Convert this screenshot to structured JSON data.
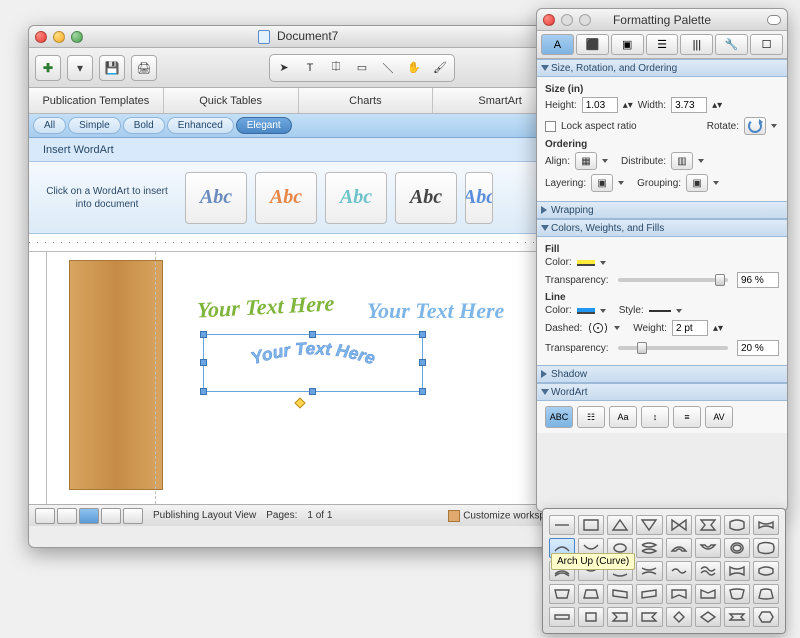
{
  "main": {
    "title": "Document7",
    "elements_tabs": [
      "Publication Templates",
      "Quick Tables",
      "Charts",
      "SmartArt"
    ],
    "filter_tabs": [
      "All",
      "Simple",
      "Bold",
      "Enhanced",
      "Elegant"
    ],
    "filter_active": "Elegant",
    "insert_label": "Insert WordArt",
    "hint": "Click on a WordArt to insert into document",
    "wa_sample": "Abc",
    "canvas_text1": "Your Text Here",
    "canvas_text2": "Your Text Here",
    "canvas_arch": "Your Text Here",
    "status_view": "Publishing Layout View",
    "status_pages_label": "Pages:",
    "status_pages_value": "1 of 1",
    "status_customize": "Customize workspace"
  },
  "palette": {
    "title": "Formatting Palette",
    "sections": {
      "size": "Size, Rotation, and Ordering",
      "wrapping": "Wrapping",
      "colors": "Colors, Weights, and Fills",
      "shadow": "Shadow",
      "wordart": "WordArt"
    },
    "size": {
      "group_label": "Size (in)",
      "height_label": "Height:",
      "height_value": "1.03",
      "width_label": "Width:",
      "width_value": "3.73",
      "lock_label": "Lock aspect ratio",
      "rotate_label": "Rotate:"
    },
    "ordering": {
      "group_label": "Ordering",
      "align_label": "Align:",
      "distribute_label": "Distribute:",
      "layering_label": "Layering:",
      "grouping_label": "Grouping:"
    },
    "fill": {
      "group_label": "Fill",
      "color_label": "Color:",
      "trans_label": "Transparency:",
      "trans_value": "96 %"
    },
    "line": {
      "group_label": "Line",
      "color_label": "Color:",
      "style_label": "Style:",
      "dashed_label": "Dashed:",
      "weight_label": "Weight:",
      "weight_value": "2 pt",
      "trans_label": "Transparency:",
      "trans_value": "20 %"
    },
    "tooltip": "Arch Up (Curve)"
  }
}
